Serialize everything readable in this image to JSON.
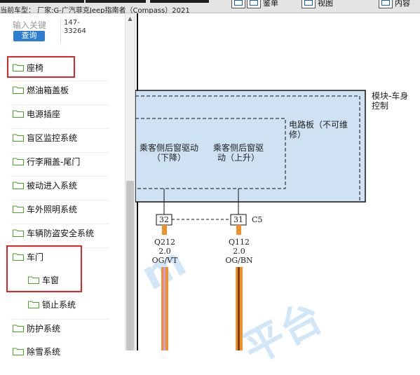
{
  "topbar": {
    "vehicle_text": "当前车型：  厂家:G-广汽菲克Jeep指南者（Compass）2021",
    "buttons": [
      {
        "label": "",
        "icon": "window-icon"
      },
      {
        "label": "鉴单",
        "icon": "list-icon"
      },
      {
        "label": "视图",
        "icon": "view-icon"
      },
      {
        "label": "内容",
        "icon": "content-icon"
      }
    ]
  },
  "search": {
    "placeholder": "输入关键",
    "button_label": "查询",
    "code_lines": [
      "147-",
      "33264"
    ]
  },
  "tree": {
    "items": [
      {
        "label": "座椅"
      },
      {
        "label": "燃油箱盖板"
      },
      {
        "label": "电源插座"
      },
      {
        "label": "盲区监控系统"
      },
      {
        "label": "行李厢盖-尾门"
      },
      {
        "label": "被动进入系统"
      },
      {
        "label": "车外照明系统"
      },
      {
        "label": "车辆防盗安全系统"
      },
      {
        "label": "车门"
      },
      {
        "label": "车窗"
      },
      {
        "label": "锁止系统"
      },
      {
        "label": "防护系统"
      },
      {
        "label": "除雪系统"
      }
    ]
  },
  "diagram": {
    "module_label": "模块-车身控制",
    "board_label": "电路板（不可维修）",
    "driver_down": "乘客侧后窗驱动（下降）",
    "driver_up": "乘客侧后窗驱动（上升）",
    "connector": "C5",
    "pins": [
      "32",
      "31"
    ],
    "wires": [
      {
        "circuit": "Q212",
        "gauge": "2.0",
        "color_code": "OG/VT"
      },
      {
        "circuit": "Q112",
        "gauge": "2.0",
        "color_code": "OG/BN"
      }
    ],
    "colors": {
      "module_fill": "#cfe2f3",
      "wire_orange": "#f0922b",
      "wire_violet": "#c8a0e0",
      "wire_brown": "#7a3e10",
      "highlight_red": "#e0252b",
      "accent_blue": "#2e7fd3"
    }
  }
}
